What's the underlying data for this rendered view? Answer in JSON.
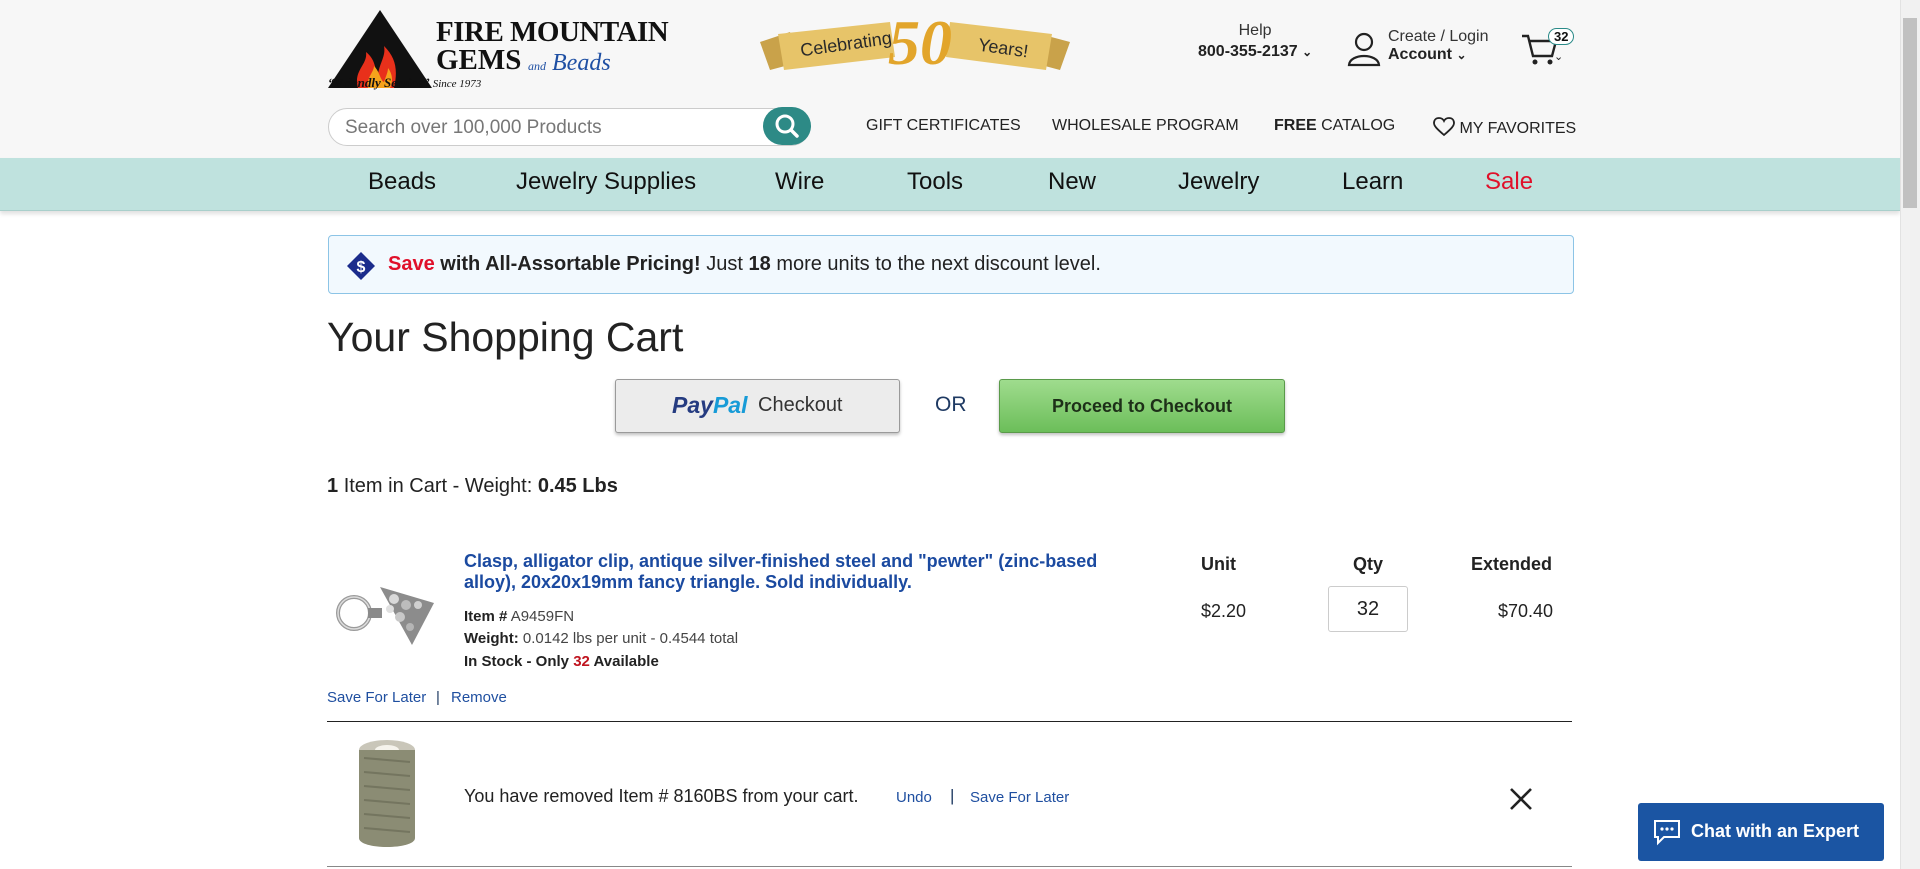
{
  "header": {
    "logo_line1": "FIRE MOUNTAIN",
    "logo_line2": "GEMS",
    "logo_and": "and",
    "logo_beads": "Beads",
    "logo_tagline_quote": "“Friendly Service”",
    "logo_tagline_since": "Since 1973",
    "banner_left": "Celebrating",
    "banner_number": "50",
    "banner_right": "Years!",
    "help_label": "Help",
    "help_phone": "800-355-2137",
    "account_line1": "Create / Login",
    "account_line2": "Account",
    "cart_count": "32"
  },
  "search": {
    "placeholder": "Search over 100,000 Products"
  },
  "top_links": {
    "gift": "GIFT CERTIFICATES",
    "wholesale": "WHOLESALE PROGRAM",
    "catalog_bold": "FREE",
    "catalog_rest": "CATALOG",
    "favorites": "MY FAVORITES"
  },
  "nav": {
    "items": [
      "Beads",
      "Jewelry Supplies",
      "Wire",
      "Tools",
      "New",
      "Jewelry",
      "Learn",
      "Sale"
    ],
    "sale_color": "#e0102a"
  },
  "promo": {
    "save": "Save",
    "bold": "with All-Assortable Pricing!",
    "pre": "Just",
    "units": "18",
    "post": "more units to the next discount level."
  },
  "cart": {
    "title": "Your Shopping Cart",
    "paypal_brand_pay": "Pay",
    "paypal_brand_pal": "Pal",
    "paypal_label": "Checkout",
    "or_label": "OR",
    "checkout_label": "Proceed to Checkout",
    "summary_count": "1",
    "summary_text": "Item in Cart - Weight:",
    "summary_weight": "0.45 Lbs",
    "columns": {
      "unit": "Unit",
      "qty": "Qty",
      "extended": "Extended"
    },
    "item": {
      "title": "Clasp, alligator clip, antique silver-finished steel and \"pewter\" (zinc-based alloy), 20x20x19mm fancy triangle. Sold individually.",
      "item_label": "Item #",
      "item_number": "A9459FN",
      "weight_label": "Weight:",
      "weight_value": "0.0142 lbs per unit - 0.4544 total",
      "stock_pre": "In Stock - Only",
      "stock_count": "32",
      "stock_post": "Available",
      "unit_price": "$2.20",
      "qty": "32",
      "extended": "$70.40",
      "save_for_later": "Save For Later",
      "remove": "Remove",
      "link_sep": "|"
    },
    "removed": {
      "text": "You have removed Item # 8160BS from your cart.",
      "undo": "Undo",
      "sep": "|",
      "save_for_later": "Save For Later"
    }
  },
  "chat": {
    "label": "Chat with an Expert"
  },
  "colors": {
    "nav_bg": "#bfe2de",
    "link": "#1b4aa0",
    "accent_teal": "#2d8a86",
    "chat_bg": "#1b55a3",
    "save_red": "#e0102a"
  }
}
